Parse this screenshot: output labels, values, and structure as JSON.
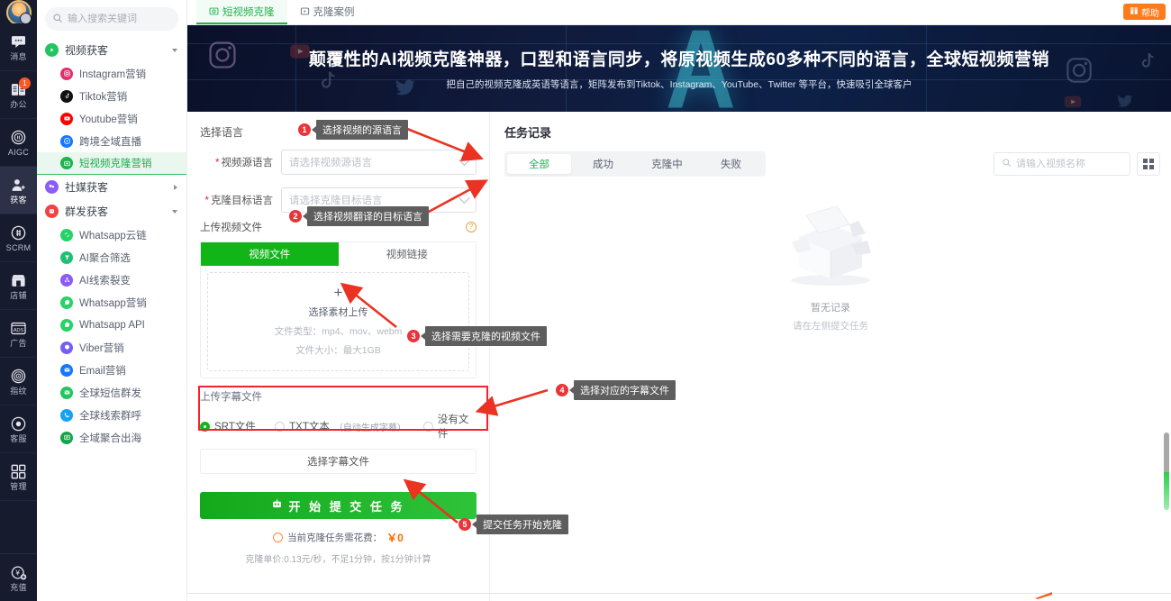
{
  "rail": {
    "items": [
      {
        "label": "消息",
        "icon": "message-icon",
        "badge": null,
        "active": false
      },
      {
        "label": "办公",
        "icon": "office-icon",
        "badge": "1",
        "active": false
      },
      {
        "label": "AIGC",
        "icon": "aigc-icon",
        "badge": null,
        "active": false
      },
      {
        "label": "获客",
        "icon": "customer-acquisition-icon",
        "badge": null,
        "active": true
      },
      {
        "label": "SCRM",
        "icon": "scrm-icon",
        "badge": null,
        "active": false
      },
      {
        "label": "店铺",
        "icon": "shop-icon",
        "badge": null,
        "active": false
      },
      {
        "label": "广告",
        "icon": "ads-icon",
        "badge": null,
        "active": false
      },
      {
        "label": "指纹",
        "icon": "fingerprint-icon",
        "badge": null,
        "active": false
      },
      {
        "label": "客服",
        "icon": "support-icon",
        "badge": null,
        "active": false
      },
      {
        "label": "管理",
        "icon": "manage-icon",
        "badge": null,
        "active": false
      }
    ],
    "bottom": {
      "label": "充值",
      "icon": "recharge-icon"
    }
  },
  "sidebar": {
    "search_placeholder": "输入搜索关键词",
    "groups": [
      {
        "label": "视频获客",
        "icon": "play-circle-icon",
        "color": "#22c55e",
        "expanded": true,
        "items": [
          {
            "label": "Instagram营销",
            "icon": "instagram-icon",
            "color": "#e1306c",
            "active": false
          },
          {
            "label": "Tiktok营销",
            "icon": "tiktok-icon",
            "color": "#111111",
            "active": false
          },
          {
            "label": "Youtube营销",
            "icon": "youtube-icon",
            "color": "#ff0000",
            "active": false
          },
          {
            "label": "跨境全域直播",
            "icon": "live-stream-icon",
            "color": "#1677ff",
            "active": false
          },
          {
            "label": "短视频克隆营销",
            "icon": "video-clone-icon",
            "color": "#22b24c",
            "active": true
          }
        ]
      },
      {
        "label": "社媒获客",
        "icon": "social-media-icon",
        "color": "#8b5cf6",
        "expanded": false,
        "items": []
      },
      {
        "label": "群发获客",
        "icon": "mass-send-icon",
        "color": "#ef4444",
        "expanded": true,
        "items": [
          {
            "label": "Whatsapp云链",
            "icon": "whatsapp-cloud-icon",
            "color": "#25d366",
            "active": false
          },
          {
            "label": "AI聚合筛选",
            "icon": "ai-filter-icon",
            "color": "#1fbf75",
            "active": false
          },
          {
            "label": "AI线索裂变",
            "icon": "ai-fission-icon",
            "color": "#8b5cf6",
            "active": false
          },
          {
            "label": "Whatsapp营销",
            "icon": "whatsapp-icon",
            "color": "#25d366",
            "active": false
          },
          {
            "label": "Whatsapp API",
            "icon": "whatsapp-api-icon",
            "color": "#25d366",
            "active": false
          },
          {
            "label": "Viber营销",
            "icon": "viber-icon",
            "color": "#7360f2",
            "active": false
          },
          {
            "label": "Email营销",
            "icon": "email-icon",
            "color": "#1677ff",
            "active": false
          },
          {
            "label": "全球短信群发",
            "icon": "sms-icon",
            "color": "#22c55e",
            "active": false
          },
          {
            "label": "全球线索群呼",
            "icon": "call-icon",
            "color": "#14a3f0",
            "active": false
          },
          {
            "label": "全域聚合出海",
            "icon": "global-aggregate-icon",
            "color": "#16a34a",
            "active": false
          }
        ]
      }
    ]
  },
  "topbar": {
    "tabs": [
      {
        "label": "短视频克隆",
        "icon": "video-clone-tab-icon",
        "active": true
      },
      {
        "label": "克隆案例",
        "icon": "case-tab-icon",
        "active": false
      }
    ],
    "help_label": "帮助",
    "help_icon": "book-icon"
  },
  "banner": {
    "title": "颠覆性的AI视频克隆神器，口型和语言同步，将原视频生成60多种不同的语言，全球短视频营销",
    "subtitle": "把自己的视频克隆成英语等语言，矩阵发布到Tiktok、Instagram、YouTube、Twitter 等平台，快速吸引全球客户"
  },
  "form": {
    "section_label": "选择语言",
    "source_language": {
      "label": "视频源语言",
      "required": true,
      "placeholder": "请选择视频源语言",
      "value": ""
    },
    "target_language": {
      "label": "克隆目标语言",
      "required": true,
      "placeholder": "请选择克隆目标语言",
      "value": ""
    },
    "upload_label": "上传视频文件",
    "upload_help_icon": "question-circle-icon",
    "upload_tabs": [
      {
        "label": "视频文件",
        "active": true
      },
      {
        "label": "视频链接",
        "active": false
      }
    ],
    "dropzone": {
      "plus": "+",
      "main": "选择素材上传",
      "file_type": "文件类型：mp4、mov、webm",
      "file_size": "文件大小：最大1GB"
    },
    "subtitle_block": {
      "label": "上传字幕文件",
      "options": [
        {
          "label": "SRT文件",
          "note": "",
          "selected": true
        },
        {
          "label": "TXT文本",
          "note": "（自动生成字幕）",
          "selected": false
        },
        {
          "label": "没有文件",
          "note": "",
          "selected": false
        }
      ],
      "pick_button": "选择字幕文件"
    },
    "submit_label": "开 始 提 交 任 务",
    "submit_icon": "robot-icon",
    "cost_label": "当前克隆任务需花费：",
    "cost_value": "￥0",
    "cost_note": "克隆单价:0.13元/秒，不足1分钟，按1分钟计算"
  },
  "records": {
    "title": "任务记录",
    "segments": [
      {
        "label": "全部",
        "active": true
      },
      {
        "label": "成功",
        "active": false
      },
      {
        "label": "克隆中",
        "active": false
      },
      {
        "label": "失败",
        "active": false
      }
    ],
    "search_placeholder": "请输入视频名称",
    "grid_icon": "grid-view-icon",
    "empty_title": "暂无记录",
    "empty_sub": "请在左侧提交任务"
  },
  "annotations": [
    {
      "num": "1",
      "text": "选择视频的源语言"
    },
    {
      "num": "2",
      "text": "选择视频翻译的目标语言"
    },
    {
      "num": "3",
      "text": "选择需要克隆的视频文件"
    },
    {
      "num": "4",
      "text": "选择对应的字幕文件"
    },
    {
      "num": "5",
      "text": "提交任务开始克隆"
    }
  ],
  "colors": {
    "accent_green": "#22b24c",
    "submit_green": "#14a81b",
    "annotation_red": "#e8353a",
    "help_orange": "#ff7a18"
  }
}
